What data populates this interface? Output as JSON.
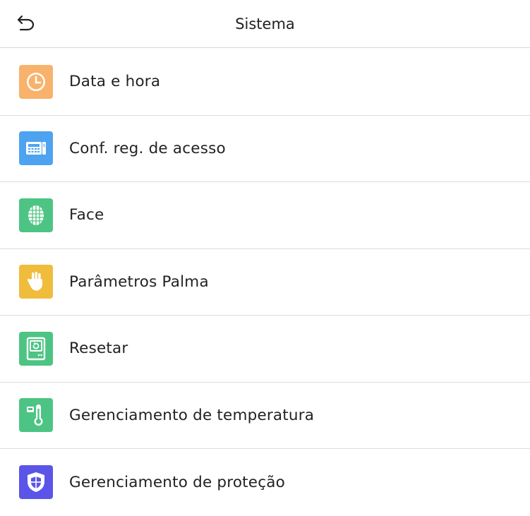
{
  "header": {
    "title": "Sistema",
    "back_icon": "back-arrow-icon"
  },
  "menu": {
    "items": [
      {
        "label": "Data e hora",
        "icon": "clock-icon",
        "color": "#f9b26b"
      },
      {
        "label": "Conf. reg. de acesso",
        "icon": "access-terminal-icon",
        "color": "#4da3f0"
      },
      {
        "label": "Face",
        "icon": "face-scan-icon",
        "color": "#4dc483"
      },
      {
        "label": "Parâmetros Palma",
        "icon": "palm-icon",
        "color": "#f0bc3c"
      },
      {
        "label": "Resetar",
        "icon": "reset-device-icon",
        "color": "#4dc483"
      },
      {
        "label": "Gerenciamento de temperatura",
        "icon": "thermometer-icon",
        "color": "#4dc483"
      },
      {
        "label": "Gerenciamento de proteção",
        "icon": "shield-icon",
        "color": "#5a55e8"
      }
    ]
  }
}
